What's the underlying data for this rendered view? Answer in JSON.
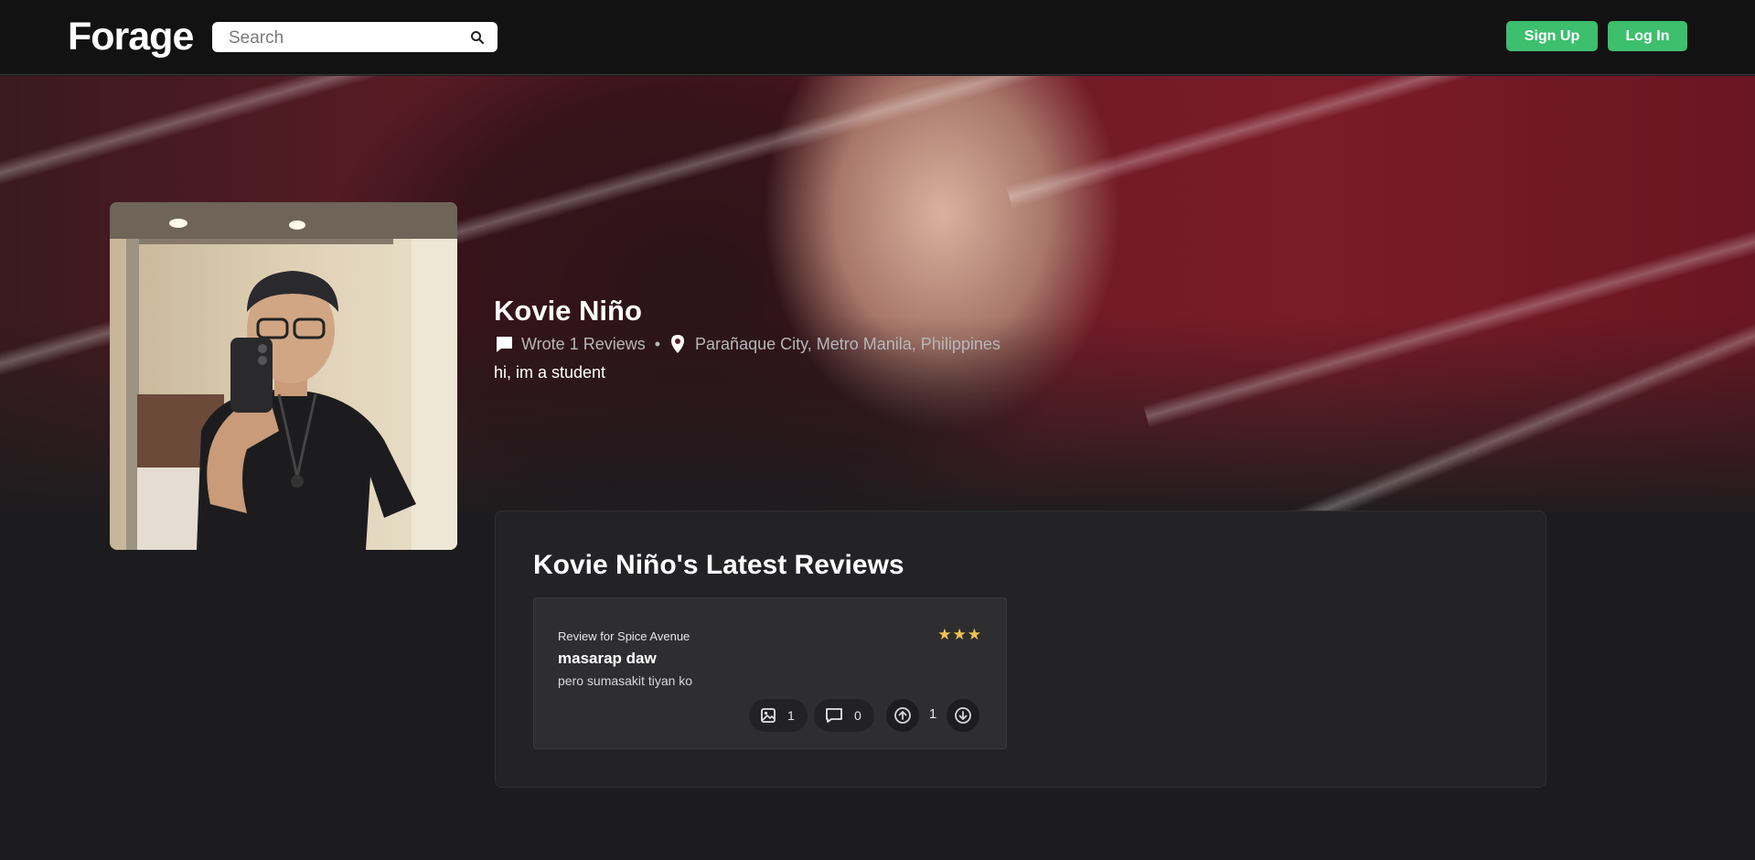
{
  "app": {
    "logo": "Forage"
  },
  "search": {
    "placeholder": "Search"
  },
  "nav": {
    "signup_label": "Sign Up",
    "login_label": "Log In"
  },
  "colors": {
    "accent_green": "#3dbf6e",
    "star_gold": "#f2c14e",
    "background": "#1c1c1e",
    "navbar": "#121213"
  },
  "profile": {
    "name": "Kovie Niño",
    "reviews_text": "Wrote 1 Reviews",
    "separator": "•",
    "location": "Parañaque City, Metro Manila, Philippines",
    "bio": "hi, im a student"
  },
  "reviews_section": {
    "title": "Kovie Niño's Latest Reviews",
    "items": [
      {
        "for_label": "Review for Spice Avenue",
        "stars": "★★★",
        "rating": 3,
        "title": "masarap daw",
        "body": "pero sumasakit tiyan ko",
        "images_count": "1",
        "comments_count": "0",
        "score": "1"
      }
    ]
  },
  "icons": {
    "search": "search-icon",
    "reviews": "speech-bubble-icon",
    "location": "map-pin-icon",
    "images": "image-icon",
    "comments": "comment-icon",
    "upvote": "arrow-up-circle-icon",
    "downvote": "arrow-down-circle-icon"
  }
}
